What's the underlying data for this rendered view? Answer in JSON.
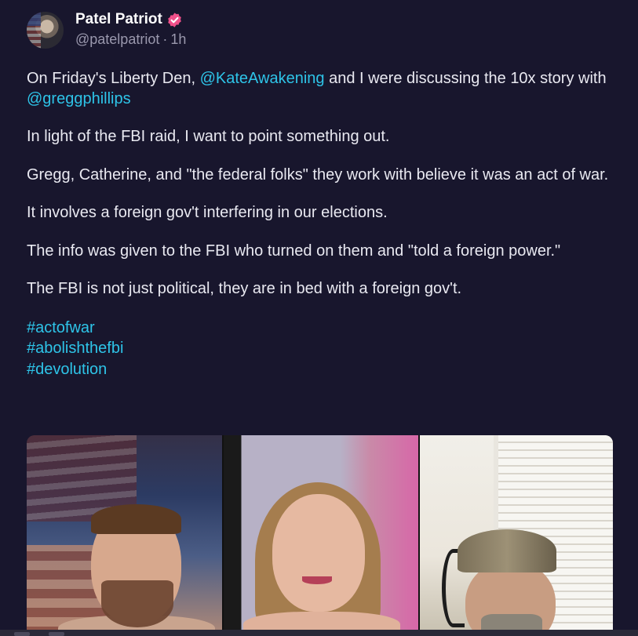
{
  "author": {
    "display_name": "Patel Patriot",
    "handle": "@patelpatriot",
    "separator": "·",
    "time_ago": "1h",
    "verified_icon": "verified-badge-icon",
    "verified_color": "#f0508a"
  },
  "post": {
    "p1_a": "On Friday's Liberty Den, ",
    "p1_mention1": "@KateAwakening",
    "p1_b": " and I were discussing the 10x story with ",
    "p1_mention2": "@greggphillips",
    "p2": "In light of the FBI raid, I want to point something out.",
    "p3": "Gregg, Catherine, and \"the federal folks\" they work with believe it was an act of war.",
    "p4": "It involves a foreign gov't interfering in our elections.",
    "p5": "The info was given to the FBI who turned on them and \"told a foreign power.\"",
    "p6": "The FBI is not just political, they are in bed with a foreign gov't.",
    "hashtags": [
      "#actofwar",
      "#abolishthefbi",
      "#devolution"
    ]
  },
  "media": {
    "kind": "video-still",
    "panes": 3
  },
  "colors": {
    "background": "#18162d",
    "link": "#2ec4e8",
    "text": "#e9e9f1",
    "muted": "#9a98ad"
  }
}
